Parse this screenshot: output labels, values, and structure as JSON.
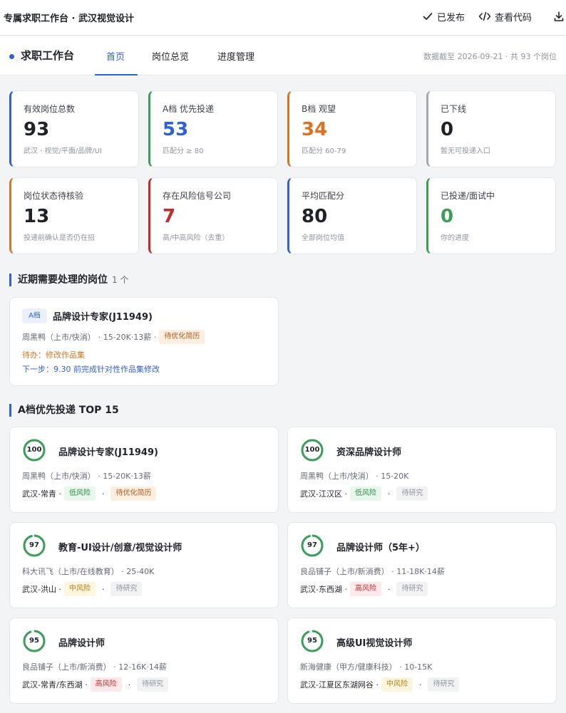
{
  "topbar": {
    "title": "专属求职工作台 · 武汉视觉设计",
    "publish_label": "已发布",
    "view_code_label": "查看代码"
  },
  "nav": {
    "brand": "求职工作台",
    "tabs": [
      {
        "label": "首页",
        "active": true
      },
      {
        "label": "岗位总览",
        "active": false
      },
      {
        "label": "进度管理",
        "active": false
      }
    ],
    "meta": "数据截至 2026-09-21 · 共 93 个岗位"
  },
  "stats": [
    {
      "label": "有效岗位总数",
      "value": "93",
      "sub": "武汉 · 视觉/平面/品牌/UI",
      "accent": "#2f5fd9",
      "value_color": "#1f2329"
    },
    {
      "label": "A档 优先投递",
      "value": "53",
      "sub": "匹配分 ≥ 80",
      "accent": "#3a9e58",
      "value_color": "#2f5fd9"
    },
    {
      "label": "B档 观望",
      "value": "34",
      "sub": "匹配分 60-79",
      "accent": "#d9731f",
      "value_color": "#d9731f"
    },
    {
      "label": "已下线",
      "value": "0",
      "sub": "暂无可投递入口",
      "accent": "#a3a8b0",
      "value_color": "#1f2329"
    },
    {
      "label": "岗位状态待核验",
      "value": "13",
      "sub": "投递前确认是否仍在招",
      "accent": "#d9731f",
      "value_color": "#1f2329"
    },
    {
      "label": "存在风险信号公司",
      "value": "7",
      "sub": "高/中高风险（去重）",
      "accent": "#c62a2a",
      "value_color": "#c62a2a"
    },
    {
      "label": "平均匹配分",
      "value": "80",
      "sub": "全部岗位均值",
      "accent": "#2f5fd9",
      "value_color": "#1f2329"
    },
    {
      "label": "已投递/面试中",
      "value": "0",
      "sub": "你的进度",
      "accent": "#3a9e58",
      "value_color": "#3a9e58"
    }
  ],
  "upcoming": {
    "title": "近期需要处理的岗位",
    "count": "1 个",
    "card": {
      "tier": "A档",
      "title": "品牌设计专家(J11949)",
      "company": "周黑鸭（上市/快消）",
      "detail": "· 15-20K·13薪 ·",
      "tag": "待优化简历",
      "todo": "待办：修改作品集",
      "next": "下一步：9.30 前完成针对性作品集修改"
    }
  },
  "top": {
    "title": "A档优先投递 TOP 15",
    "jobs": [
      {
        "score": "100",
        "score_pct": 1.0,
        "title": "品牌设计专家(J11949)",
        "company": "周黑鸭（上市/快消） · 15-20K·13薪",
        "location": "武汉-常青 ·",
        "risk": "低风险",
        "risk_class": "tag-green",
        "status": "待优化简历",
        "status_class": "tag-orange"
      },
      {
        "score": "100",
        "score_pct": 1.0,
        "title": "资深品牌设计师",
        "company": "周黑鸭（上市/快消） · 15-20K",
        "location": "武汉-江汉区 ·",
        "risk": "低风险",
        "risk_class": "tag-green",
        "status": "待研究",
        "status_class": "tag-gray"
      },
      {
        "score": "97",
        "score_pct": 0.97,
        "title": "教育-UI设计/创意/视觉设计师",
        "company": "科大讯飞（上市/在线教育） · 25-40K",
        "location": "武汉-洪山 ·",
        "risk": "中风险",
        "risk_class": "tag-yellow",
        "status": "待研究",
        "status_class": "tag-gray"
      },
      {
        "score": "97",
        "score_pct": 0.97,
        "title": "品牌设计师（5年+）",
        "company": "良品铺子（上市/新消费） · 11-18K·14薪",
        "location": "武汉-东西湖 ·",
        "risk": "高风险",
        "risk_class": "tag-red",
        "status": "待研究",
        "status_class": "tag-gray"
      },
      {
        "score": "95",
        "score_pct": 0.95,
        "title": "品牌设计师",
        "company": "良品铺子（上市/新消费） · 12-16K·14薪",
        "location": "武汉-常青/东西湖 ·",
        "risk": "高风险",
        "risk_class": "tag-red",
        "status": "待研究",
        "status_class": "tag-gray"
      },
      {
        "score": "95",
        "score_pct": 0.95,
        "title": "高级UI视觉设计师",
        "company": "新海健康（甲方/健康科技） · 10-15K",
        "location": "武汉-江夏区东湖网谷 ·",
        "risk": "中风险",
        "risk_class": "tag-yellow",
        "status": "待研究",
        "status_class": "tag-gray"
      }
    ]
  },
  "colors": {
    "accent": "#2f5fd9",
    "score_ring": "#3a9e58",
    "todo_orange": "#d9731f"
  }
}
